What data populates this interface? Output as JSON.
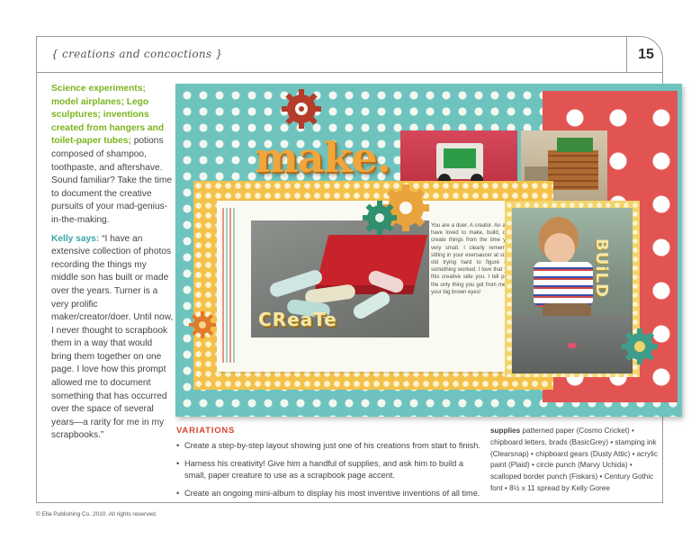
{
  "header": {
    "section_title": "{ creations and concoctions }",
    "page_number": "15"
  },
  "intro": {
    "highlight": "Science experiments; model airplanes; Lego sculptures; inventions created from hangers and toilet-paper tubes;",
    "body": " potions composed of shampoo, toothpaste, and aftershave. Sound familiar? Take the time to document the creative pursuits of your mad-genius-in-the-making."
  },
  "quote": {
    "speaker": "Kelly says:",
    "text": " “I have an extensive collection of photos recording the things my middle son has built or made over the years. Turner is a very prolific maker/creator/doer. Until now, I never thought to scrapbook them in a way that would bring them together on one page. I love how this prompt allowed me to document something that has occurred over the space of several years—a rarity for me in my scrapbooks.”"
  },
  "layout": {
    "title_word": "make.",
    "create_word": "CReaTe",
    "build_word": "BUiLD",
    "journaling": "You are a doer. A creator. An artist. You have loved to make, build, draw and create things from the time you were very small. I clearly remember you sitting in your exersaucer at six months old trying hard to figure out how something worked. I love that you have this creative side you. I tell people it's the only thing you got from me besides your big brown eyes!"
  },
  "variations": {
    "heading": "VARIATIONS",
    "items": [
      "Create a step-by-step layout showing just one of his creations from start to finish.",
      "Harness his creativity! Give him a handful of supplies, and ask him to build a small, paper creature to use as a scrapbook page accent.",
      "Create an ongoing mini-album to display his most inventive inventions of all time."
    ]
  },
  "supplies": {
    "heading": "supplies",
    "text": " patterned paper (Cosmo Cricket) • chipboard letters, brads (BasicGrey) • stamping ink (Clearsnap) • chipboard gears (Dusty Attic) • acrylic paint (Plaid) • circle punch (Marvy Uchida) • scalloped border punch (Fiskars) • Century Gothic font • 8½ x 11 spread by Kelly Goree"
  },
  "footer": {
    "copyright": "© Ella Publishing Co. 2010. All rights reserved."
  },
  "colors": {
    "accent_green": "#7ab51d",
    "accent_teal": "#3aa6a8",
    "accent_red": "#d6452e"
  }
}
